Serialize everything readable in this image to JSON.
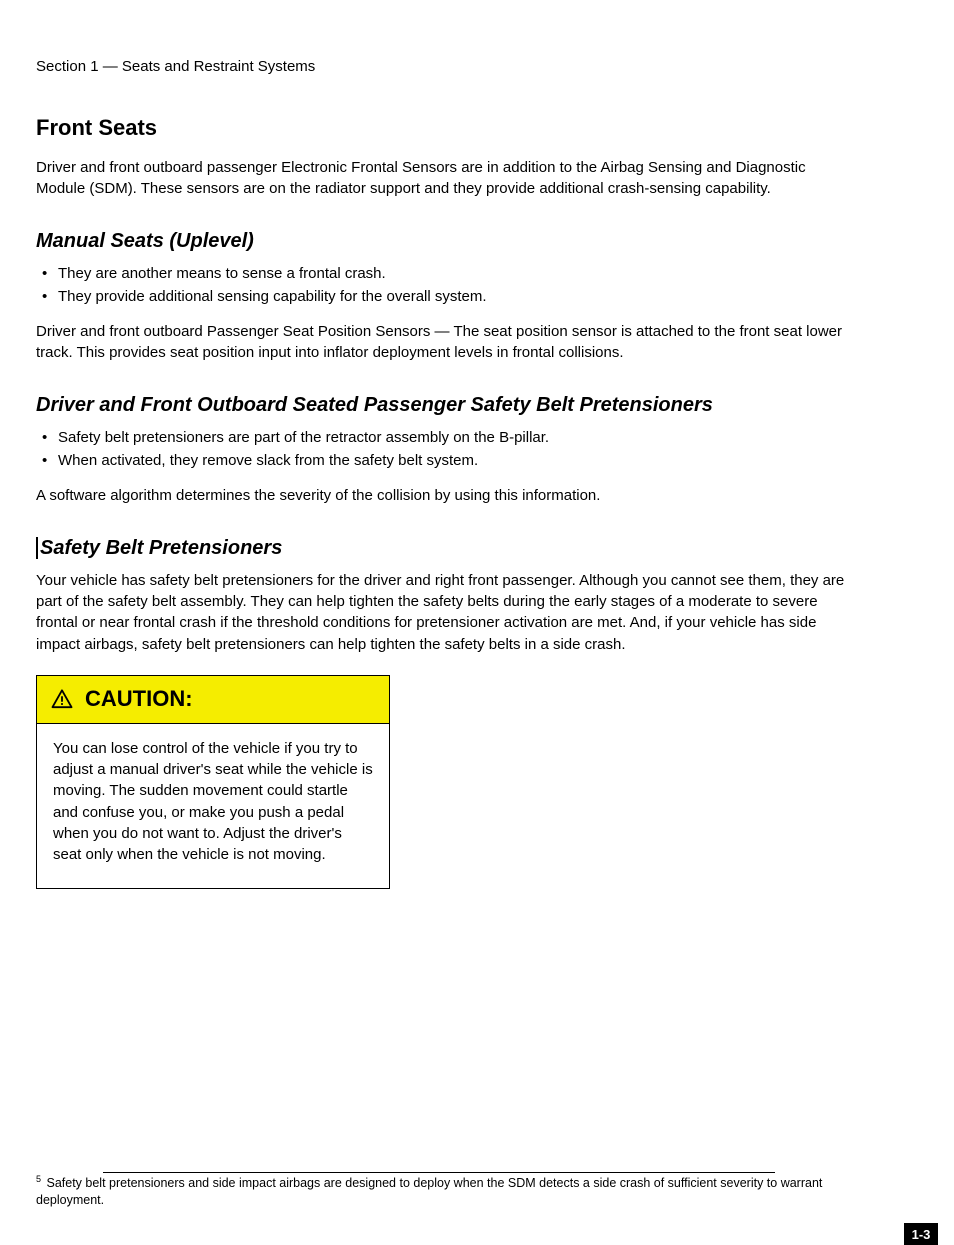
{
  "breadcrumb": "Section 1 — Seats and Restraint Systems",
  "h1": "Front Seats",
  "intro": "Driver and front outboard passenger Electronic Frontal Sensors are in addition to the Airbag Sensing and Diagnostic Module (SDM). These sensors are on the radiator support and they provide additional crash-sensing capability.",
  "section1": {
    "title": "Manual Seats (Uplevel)",
    "bullets": [
      "They are another means to sense a frontal crash.",
      "They provide additional sensing capability for the overall system."
    ],
    "para": "Driver and front outboard Passenger Seat Position Sensors — The seat position sensor is attached to the front seat lower track. This provides seat position input into inflator deployment levels in frontal collisions."
  },
  "section2": {
    "title": "Driver and Front Outboard Seated Passenger Safety Belt Pretensioners",
    "bullets": [
      "Safety belt pretensioners are part of the retractor assembly on the B-pillar.",
      "When activated, they remove slack from the safety belt system."
    ],
    "last": "A software algorithm determines the severity of the collision by using this information."
  },
  "h2": "Safety Belt Pretensioners",
  "body_para": "Your vehicle has safety belt pretensioners for the driver and right front passenger. Although you cannot see them, they are part of the safety belt assembly. They can help tighten the safety belts during the early stages of a moderate to severe frontal or near frontal crash if the threshold conditions for pretensioner activation are met. And, if your vehicle has side impact airbags, safety belt pretensioners can help tighten the safety belts in a side crash.",
  "caution": {
    "label": "CAUTION:",
    "text": "You can lose control of the vehicle if you try to adjust a manual driver's seat while the vehicle is moving. The sudden movement could startle and confuse you, or make you push a pedal when you do not want to. Adjust the driver's seat only when the vehicle is not moving."
  },
  "footnote": {
    "marker": "5",
    "text": " Safety belt pretensioners and side impact airbags are designed to deploy when the SDM detects a side crash of sufficient severity to warrant deployment."
  },
  "page": "1-3"
}
